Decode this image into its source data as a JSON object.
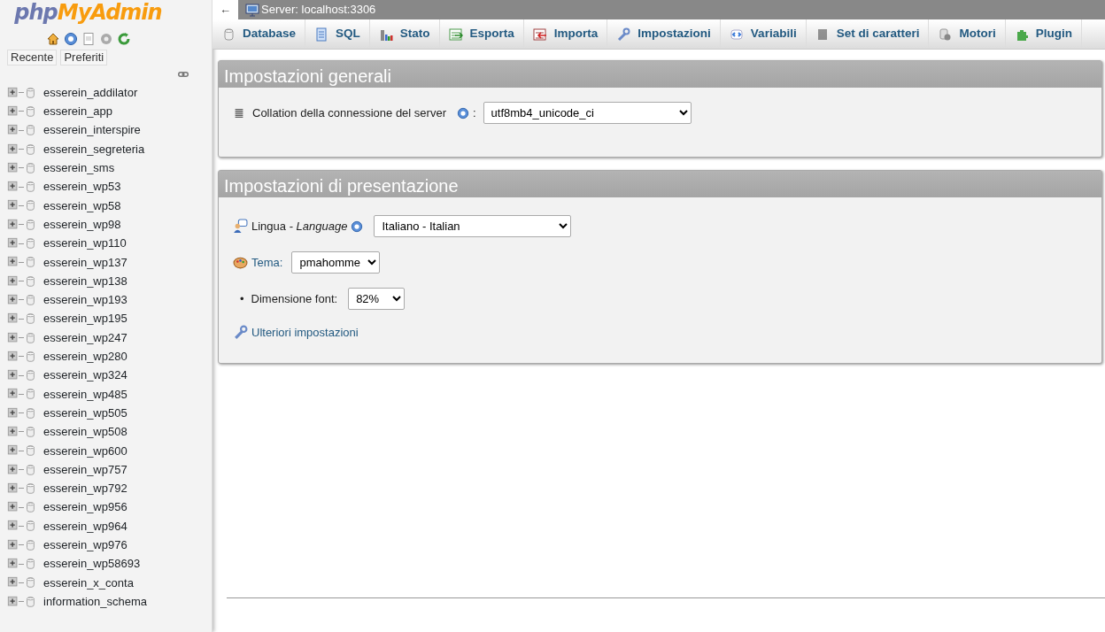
{
  "sidebar": {
    "logo": {
      "first": "php",
      "second": "MyAdmin"
    },
    "buttons": [
      "Recente",
      "Preferiti"
    ],
    "databases": [
      "esserein_addilator",
      "esserein_app",
      "esserein_interspire",
      "esserein_segreteria",
      "esserein_sms",
      "esserein_wp53",
      "esserein_wp58",
      "esserein_wp98",
      "esserein_wp110",
      "esserein_wp137",
      "esserein_wp138",
      "esserein_wp193",
      "esserein_wp195",
      "esserein_wp247",
      "esserein_wp280",
      "esserein_wp324",
      "esserein_wp485",
      "esserein_wp505",
      "esserein_wp508",
      "esserein_wp600",
      "esserein_wp757",
      "esserein_wp792",
      "esserein_wp956",
      "esserein_wp964",
      "esserein_wp976",
      "esserein_wp58693",
      "esserein_x_conta",
      "information_schema"
    ]
  },
  "breadcrumb": {
    "back": "←",
    "server": "Server: localhost:3306"
  },
  "tabs": [
    {
      "label": "Database",
      "kind": "database",
      "selected": false
    },
    {
      "label": "SQL",
      "kind": "sql",
      "selected": false
    },
    {
      "label": "Stato",
      "kind": "status",
      "selected": false
    },
    {
      "label": "Esporta",
      "kind": "export",
      "selected": false
    },
    {
      "label": "Importa",
      "kind": "import",
      "selected": false
    },
    {
      "label": "Impostazioni",
      "kind": "settings",
      "selected": false
    },
    {
      "label": "Variabili",
      "kind": "variables",
      "selected": false
    },
    {
      "label": "Set di caratteri",
      "kind": "charset",
      "selected": false
    },
    {
      "label": "Motori",
      "kind": "engines",
      "selected": false
    },
    {
      "label": "Plugin",
      "kind": "plugins",
      "selected": false
    }
  ],
  "general": {
    "title": "Impostazioni generali",
    "collation_label": "Collation della connessione del server",
    "colon": ":",
    "collation_value": "utf8mb4_unicode_ci"
  },
  "presentation": {
    "title": "Impostazioni di presentazione",
    "language_label": "Lingua - *Language*",
    "language_value": "Italiano - Italian",
    "theme_label": "Tema:",
    "theme_value": "pmahomme",
    "bullet": "•",
    "font_label": "Dimensione font:",
    "font_value": "82%",
    "more_link": "Ulteriori impostazioni"
  }
}
